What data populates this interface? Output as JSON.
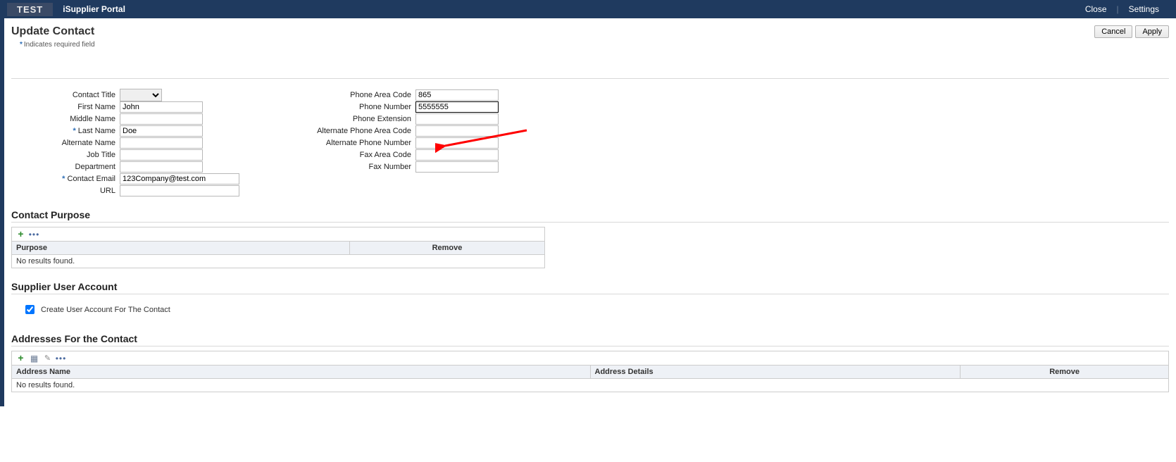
{
  "appbar": {
    "logo": "TEST",
    "portal_title": "iSupplier Portal",
    "close": "Close",
    "settings": "Settings"
  },
  "header": {
    "title": "Update Contact",
    "cancel": "Cancel",
    "apply": "Apply"
  },
  "required_note": "Indicates required field",
  "form": {
    "left": {
      "contact_title_label": "Contact Title",
      "contact_title_value": "",
      "first_name_label": "First Name",
      "first_name_value": "John",
      "middle_name_label": "Middle Name",
      "middle_name_value": "",
      "last_name_label": "Last Name",
      "last_name_value": "Doe",
      "alternate_name_label": "Alternate Name",
      "alternate_name_value": "",
      "job_title_label": "Job Title",
      "job_title_value": "",
      "department_label": "Department",
      "department_value": "",
      "contact_email_label": "Contact Email",
      "contact_email_value": "123Company@test.com",
      "url_label": "URL",
      "url_value": ""
    },
    "right": {
      "phone_area_code_label": "Phone Area Code",
      "phone_area_code_value": "865",
      "phone_number_label": "Phone Number",
      "phone_number_value": "5555555",
      "phone_extension_label": "Phone Extension",
      "phone_extension_value": "",
      "alt_phone_area_code_label": "Alternate Phone Area Code",
      "alt_phone_area_code_value": "",
      "alt_phone_number_label": "Alternate Phone Number",
      "alt_phone_number_value": "",
      "fax_area_code_label": "Fax Area Code",
      "fax_area_code_value": "",
      "fax_number_label": "Fax Number",
      "fax_number_value": ""
    }
  },
  "contact_purpose": {
    "section_title": "Contact Purpose",
    "col_purpose": "Purpose",
    "col_remove": "Remove",
    "empty": "No results found."
  },
  "supplier_user": {
    "section_title": "Supplier User Account",
    "checkbox_label": "Create User Account For The Contact",
    "checked": true
  },
  "addresses": {
    "section_title": "Addresses For the Contact",
    "col_name": "Address Name",
    "col_details": "Address Details",
    "col_remove": "Remove",
    "empty": "No results found."
  }
}
